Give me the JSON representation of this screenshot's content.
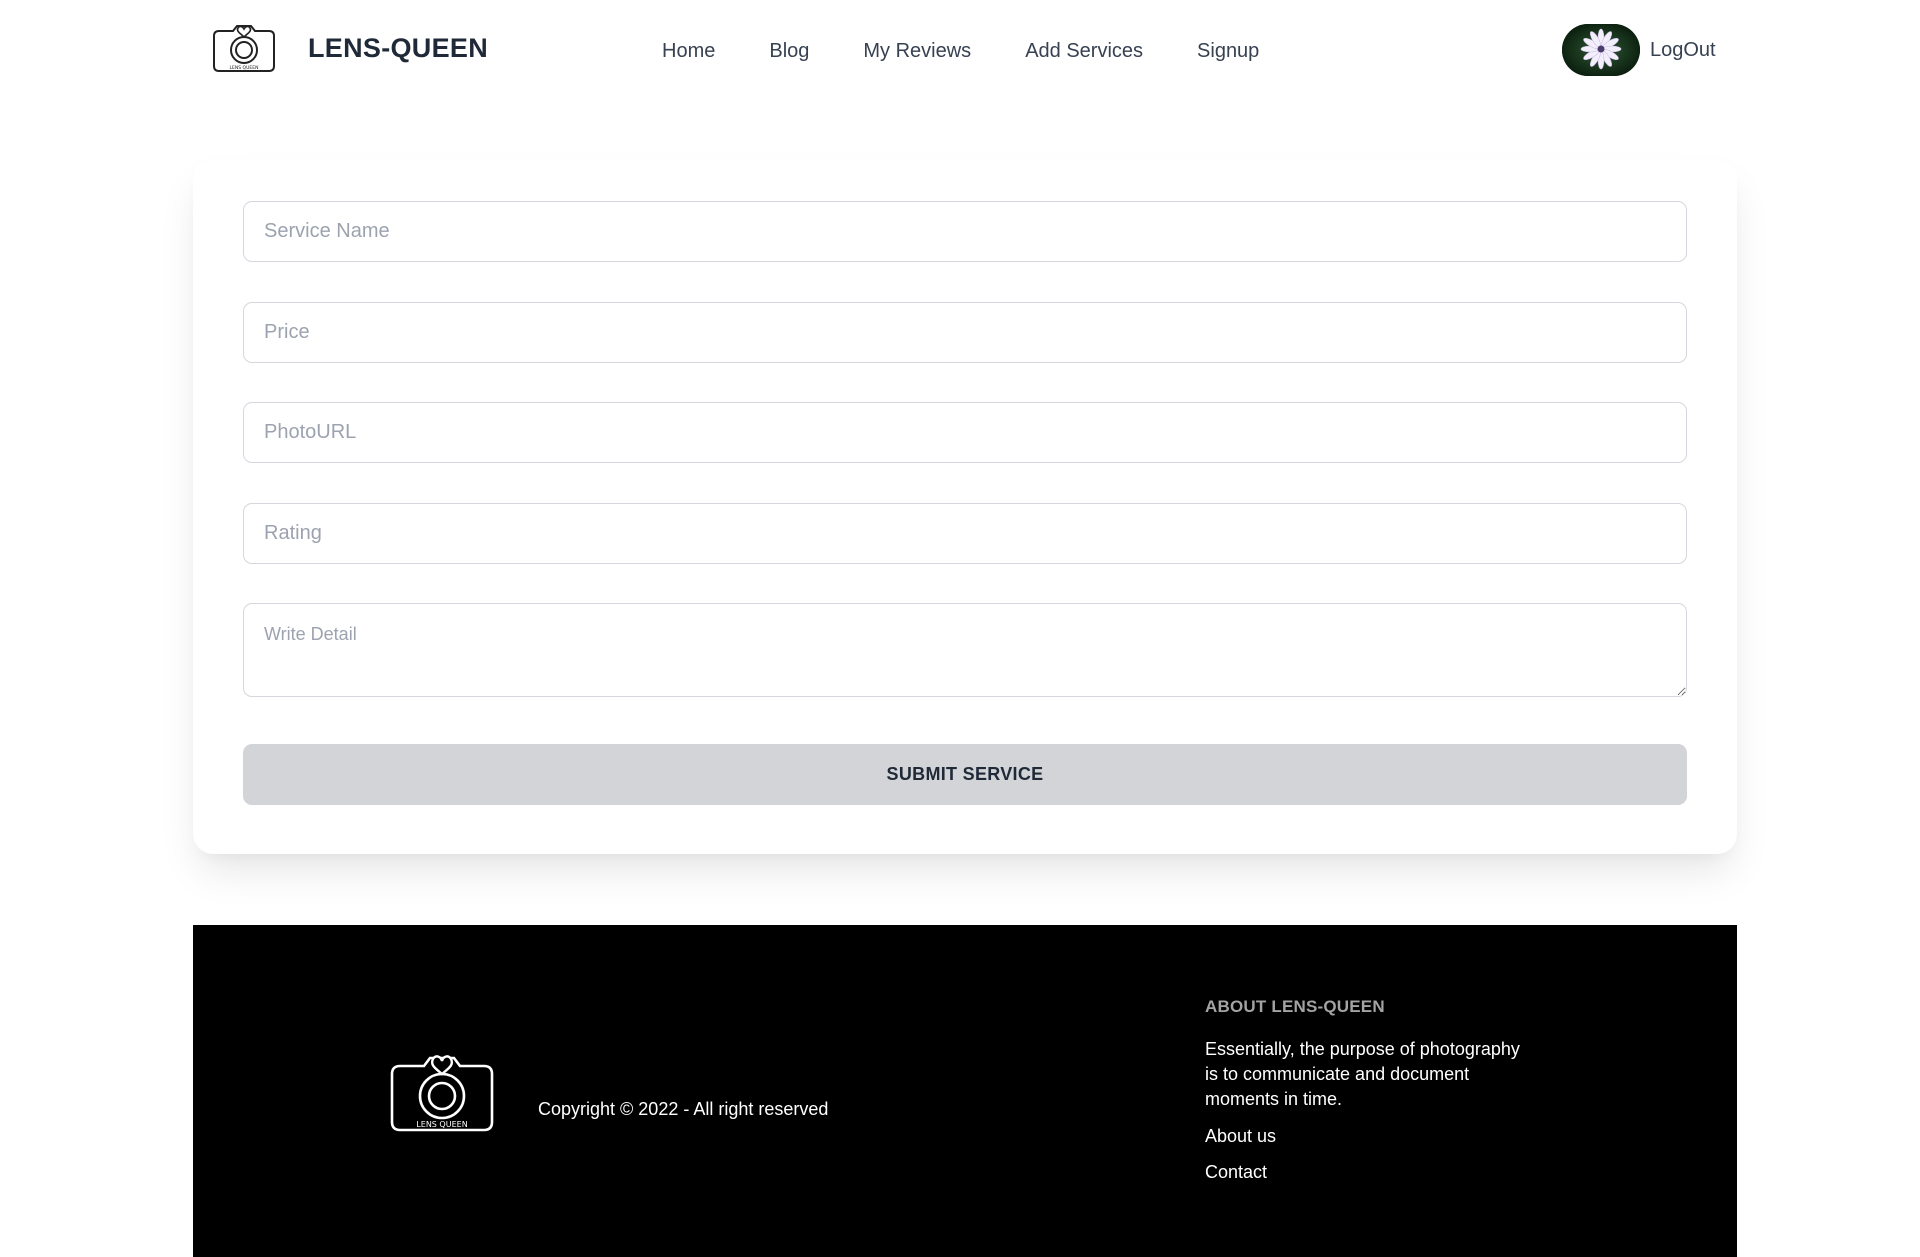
{
  "brand": {
    "name": "LENS-QUEEN",
    "logo_text": "LENS QUEEN"
  },
  "nav": {
    "items": [
      "Home",
      "Blog",
      "My Reviews",
      "Add Services",
      "Signup"
    ],
    "logout_label": "LogOut"
  },
  "form": {
    "service_name_placeholder": "Service Name",
    "price_placeholder": "Price",
    "photo_url_placeholder": "PhotoURL",
    "rating_placeholder": "Rating",
    "detail_placeholder": "Write Detail",
    "submit_label": "SUBMIT SERVICE"
  },
  "footer": {
    "copyright": "Copyright © 2022 - All right reserved",
    "about_title": "ABOUT LENS-QUEEN",
    "about_text": "Essentially, the purpose of photography is to communicate and document moments in time.",
    "links": [
      "About us",
      "Contact"
    ]
  },
  "colors": {
    "footer_bg": "#000000",
    "button_bg": "#d3d4d8",
    "text_dark": "#1f2937",
    "about_title": "#a3a3a3"
  },
  "icons": {
    "brand_logo": "camera-heart-icon",
    "avatar": "flower-avatar",
    "footer_logo": "camera-heart-icon"
  }
}
